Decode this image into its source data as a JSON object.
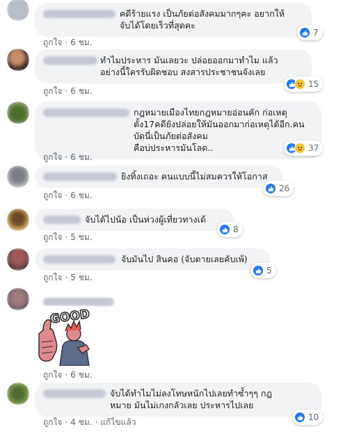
{
  "colors": {
    "like": "#2078f4",
    "sad": "#f5c33b",
    "bubble": "#f2f3f5",
    "meta": "#606770"
  },
  "comments": [
    {
      "text": "คดีร้ายแรง เป็นภัยต่อสังคมมากๆคะ อยากให้\nจับได้โดยเร็วที่สุดคะ",
      "like": "ถูกใจ",
      "time": "6 ชม.",
      "reactions": [
        "like-icon"
      ],
      "count": "7"
    },
    {
      "text": "ทำไมประหาร มันเลยวะ ปล่อยออกมาทำไม แล้ว\nอย่างนี้ใครรับผิดชอบ สงสารประชาชนจังเลย",
      "like": "ถูกใจ",
      "time": "6 ชม.",
      "reactions": [
        "like-icon",
        "sad-icon"
      ],
      "count": "15"
    },
    {
      "text": "กฎหมายเมืองไทยกฎหมายอ่อนคัก ก่อเหตุ\nตั้ง17คดียังปล่อยให้มันออกมาก่อเหตุได้อีก.คนบัดนี่เป็นภัยต่อสังคม\nคือบ่ประหารมันโลด..",
      "like": "ถูกใจ",
      "time": "6 ชม.",
      "reactions": [
        "like-icon",
        "sad-icon"
      ],
      "count": "37"
    },
    {
      "text": "ยิงทิ้งเถอะ คนแบบนี้ไม่สมควรให้โอกาส",
      "like": "ถูกใจ",
      "time": "6 ชม.",
      "reactions": [
        "like-icon"
      ],
      "count": "26"
    },
    {
      "text": "จับได้ไปน้อ เป็นห่วงผู้เที่ยวทางเด้",
      "like": "ถูกใจ",
      "time": "5 ชม.",
      "reactions": [
        "like-icon"
      ],
      "count": "8"
    },
    {
      "text": "จับมันไป สินคอ (จับตายเลยคับเพ้)",
      "like": "ถูกใจ",
      "time": "5 ชม.",
      "reactions": [
        "like-icon"
      ],
      "count": "5"
    },
    {
      "text": "",
      "sticker_text": "GOOD",
      "like": "ถูกใจ",
      "time": "6 ชม."
    },
    {
      "text": "จับได้ทำไมไม่ลงโทษหนักไปเลยทำซ้ำๆๆ กฎ\nหมาย มันไม่เกงกลัวเลย ประหารไปเลย",
      "like": "ถูกใจ",
      "time": "4 ชม.",
      "edited": "แก้ไขแล้ว",
      "reactions": [
        "like-icon"
      ],
      "count": "10"
    }
  ]
}
